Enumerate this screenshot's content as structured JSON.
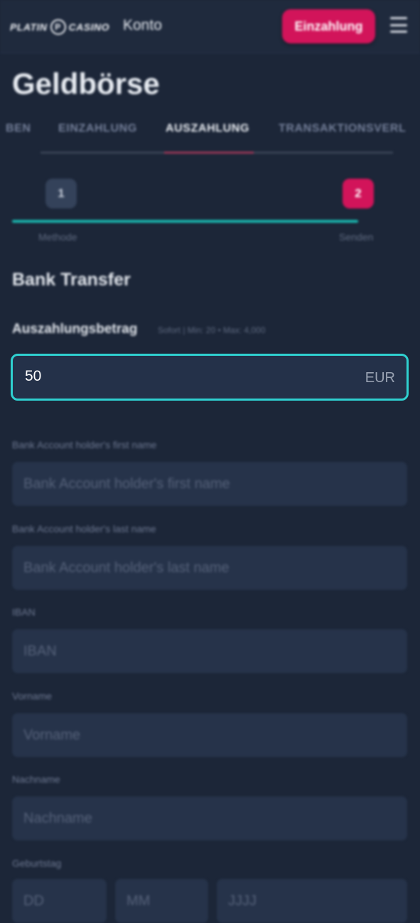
{
  "header": {
    "logo_left": "PLATIN",
    "logo_right": "CASINO",
    "account_label": "Konto",
    "deposit_button": "Einzahlung"
  },
  "page_title": "Geldbörse",
  "tabs": [
    {
      "label": "BEN"
    },
    {
      "label": "EINZAHLUNG"
    },
    {
      "label": "AUSZAHLUNG",
      "active": true
    },
    {
      "label": "TRANSAKTIONSVERL"
    }
  ],
  "steps": [
    {
      "number": "1",
      "label": "Methode"
    },
    {
      "number": "2",
      "label": "Senden"
    }
  ],
  "method_title": "Bank Transfer",
  "amount": {
    "label": "Auszahlungsbetrag",
    "hint": "Sofort | Min: 20 • Max: 4,000",
    "value": "50",
    "currency": "EUR"
  },
  "fields": [
    {
      "label": "Bank Account holder's first name",
      "placeholder": "Bank Account holder's first name"
    },
    {
      "label": "Bank Account holder's last name",
      "placeholder": "Bank Account holder's last name"
    },
    {
      "label": "IBAN",
      "placeholder": "IBAN"
    },
    {
      "label": "Vorname",
      "placeholder": "Vorname"
    },
    {
      "label": "Nachname",
      "placeholder": "Nachname"
    }
  ],
  "birthday": {
    "label": "Geburtstag",
    "day": "DD",
    "month": "MM",
    "year": "JJJJ"
  },
  "colors": {
    "background": "#1c2638",
    "accent_pink": "#d2145a",
    "accent_teal": "#2fd0d0"
  }
}
